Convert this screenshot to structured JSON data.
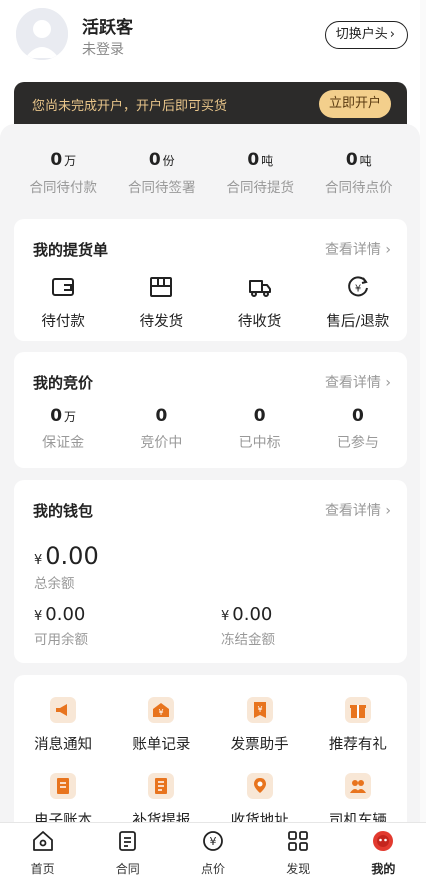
{
  "profile": {
    "name": "活跃客",
    "status": "未登录",
    "switch_label": "切换户头"
  },
  "banner": {
    "text": "您尚未完成开户，开户后即可买货",
    "button": "立即开户"
  },
  "stats": [
    {
      "value": "0",
      "unit": "万",
      "label": "合同待付款"
    },
    {
      "value": "0",
      "unit": "份",
      "label": "合同待签署"
    },
    {
      "value": "0",
      "unit": "吨",
      "label": "合同待提货"
    },
    {
      "value": "0",
      "unit": "吨",
      "label": "合同待点价"
    }
  ],
  "delivery": {
    "title": "我的提货单",
    "more": "查看详情",
    "items": [
      {
        "label": "待付款",
        "icon": "wallet-icon"
      },
      {
        "label": "待发货",
        "icon": "box-icon"
      },
      {
        "label": "待收货",
        "icon": "truck-icon"
      },
      {
        "label": "售后/退款",
        "icon": "refund-icon"
      }
    ]
  },
  "bidding": {
    "title": "我的竞价",
    "more": "查看详情",
    "items": [
      {
        "value": "0",
        "unit": "万",
        "label": "保证金"
      },
      {
        "value": "0",
        "unit": "",
        "label": "竞价中"
      },
      {
        "value": "0",
        "unit": "",
        "label": "已中标"
      },
      {
        "value": "0",
        "unit": "",
        "label": "已参与"
      }
    ]
  },
  "wallet": {
    "title": "我的钱包",
    "more": "查看详情",
    "currency": "¥",
    "total": "0.00",
    "total_label": "总余额",
    "available": "0.00",
    "available_label": "可用余额",
    "frozen": "0.00",
    "frozen_label": "冻结金额"
  },
  "tools": [
    {
      "label": "消息通知",
      "icon": "megaphone-icon"
    },
    {
      "label": "账单记录",
      "icon": "bill-icon"
    },
    {
      "label": "发票助手",
      "icon": "invoice-icon"
    },
    {
      "label": "推荐有礼",
      "icon": "gift-icon"
    },
    {
      "label": "电子账本",
      "icon": "ledger-icon"
    },
    {
      "label": "补货提报",
      "icon": "report-icon"
    },
    {
      "label": "收货地址",
      "icon": "location-icon"
    },
    {
      "label": "司机车辆",
      "icon": "driver-icon"
    }
  ],
  "tabbar": [
    {
      "label": "首页",
      "icon": "home-icon"
    },
    {
      "label": "合同",
      "icon": "contract-icon"
    },
    {
      "label": "点价",
      "icon": "price-icon"
    },
    {
      "label": "发现",
      "icon": "discover-icon"
    },
    {
      "label": "我的",
      "icon": "profile-icon"
    }
  ],
  "colors": {
    "accent": "#e8741e",
    "banner_bg": "#2c2b2a",
    "banner_text": "#e8c58a",
    "banner_button": "#f3cf8c",
    "active_tab": "#e23a2f"
  }
}
